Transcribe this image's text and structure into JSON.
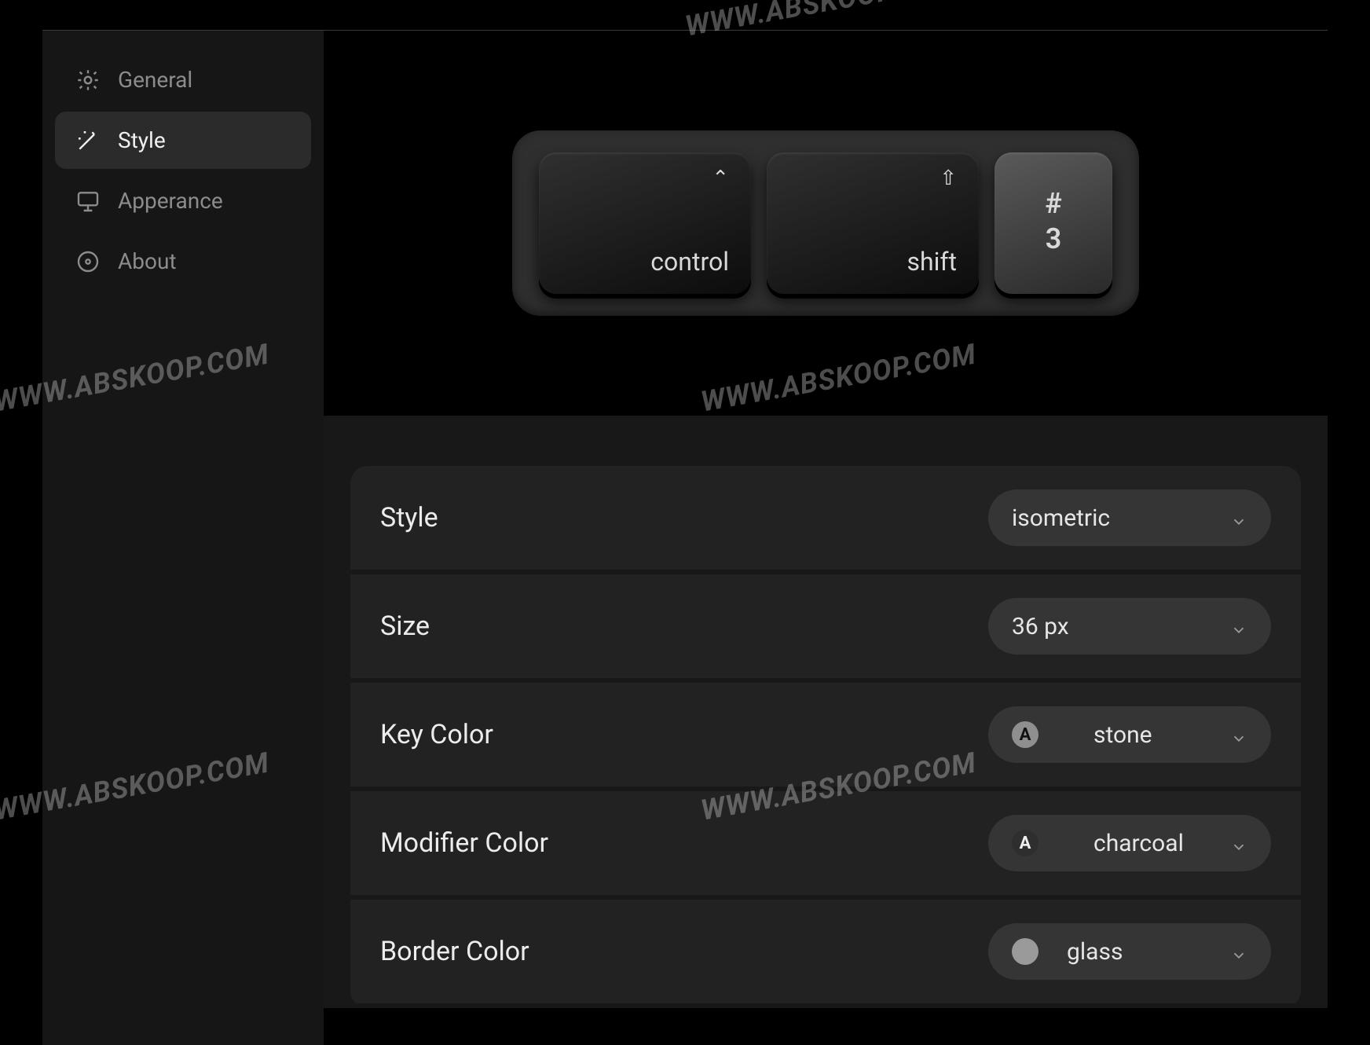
{
  "watermark": "WWW.ABSKOOP.COM",
  "sidebar": {
    "items": [
      {
        "label": "General",
        "icon": "gear-icon"
      },
      {
        "label": "Style",
        "icon": "wand-icon"
      },
      {
        "label": "Apperance",
        "icon": "monitor-icon"
      },
      {
        "label": "About",
        "icon": "disc-icon"
      }
    ],
    "active_index": 1
  },
  "preview": {
    "keys": [
      {
        "symbol": "⌃",
        "label": "control",
        "kind": "modifier"
      },
      {
        "symbol": "⇧",
        "label": "shift",
        "kind": "modifier"
      },
      {
        "symbol": "#",
        "label": "3",
        "kind": "key"
      }
    ]
  },
  "settings": {
    "rows": [
      {
        "label": "Style",
        "value": "isometric",
        "color_swatch": null,
        "letter": null
      },
      {
        "label": "Size",
        "value": "36 px",
        "color_swatch": null,
        "letter": null
      },
      {
        "label": "Key Color",
        "value": "stone",
        "color_swatch": "#8f8f8f",
        "letter": "A"
      },
      {
        "label": "Modifier Color",
        "value": "charcoal",
        "color_swatch": "#2e2e2e",
        "letter": "A"
      },
      {
        "label": "Border Color",
        "value": "glass",
        "color_swatch": "#9a9a9a",
        "letter": null
      }
    ]
  }
}
